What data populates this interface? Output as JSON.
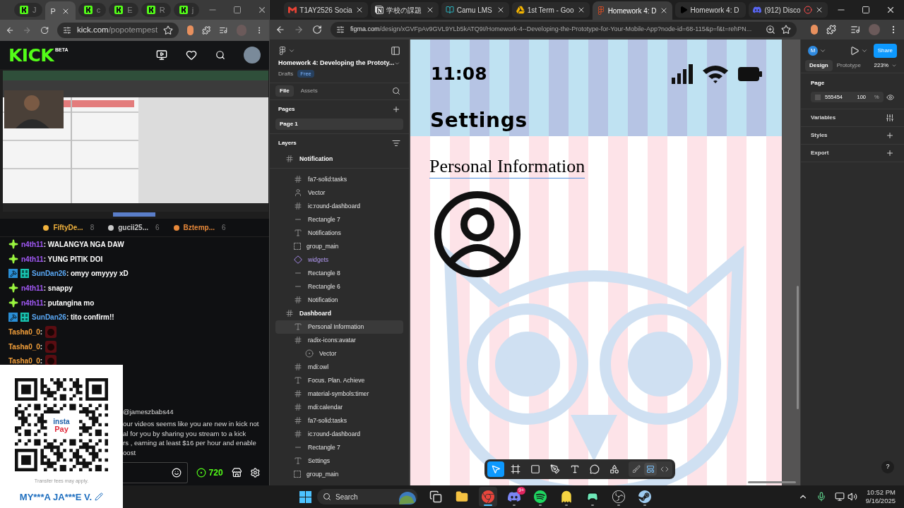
{
  "left_browser": {
    "tabs": [
      {
        "label": "J",
        "kind": "kick",
        "selected": false
      },
      {
        "label": "P",
        "kind": "none",
        "selected": true
      },
      {
        "label": "c",
        "kind": "kick",
        "selected": false
      },
      {
        "label": "E",
        "kind": "kick",
        "selected": false
      },
      {
        "label": "R",
        "kind": "kick",
        "selected": false
      },
      {
        "label": "j",
        "kind": "kick",
        "selected": false
      }
    ],
    "url": {
      "domain": "kick.com",
      "path": "/popotempest"
    },
    "site": {
      "logo": "KICK",
      "logo_badge": "BETA"
    },
    "gifters": [
      {
        "name": "FiftyDe...",
        "count": "8",
        "color": "#f2b33d"
      },
      {
        "name": "gucii25...",
        "count": "6",
        "color": "#c9c9c9"
      },
      {
        "name": "Bztemp...",
        "count": "6",
        "color": "#e8893a"
      }
    ],
    "chat": [
      {
        "user": "n4th11",
        "text": ": WALANGYA NGA DAW",
        "color": "#a259f7",
        "kind": "sparkle",
        "emote": false
      },
      {
        "user": "n4th11",
        "text": ": YUNG PITIK DOI",
        "color": "#a259f7",
        "kind": "sparkle",
        "emote": false
      },
      {
        "user": "SunDan26",
        "text": ": omyy omyyyy xD",
        "color": "#5aa8f5",
        "kind": "mod",
        "emote": false
      },
      {
        "user": "n4th11",
        "text": ": snappy",
        "color": "#a259f7",
        "kind": "sparkle",
        "emote": false
      },
      {
        "user": "n4th11",
        "text": ": putangina mo",
        "color": "#a259f7",
        "kind": "sparkle",
        "emote": false
      },
      {
        "user": "SunDan26",
        "text": ": tito confirm!!",
        "color": "#5aa8f5",
        "kind": "mod",
        "emote": false
      },
      {
        "user": "Tasha0_0",
        "text": ":",
        "color": "#f5a03a",
        "kind": "none",
        "emote": true
      },
      {
        "user": "Tasha0_0",
        "text": ":",
        "color": "#f5a03a",
        "kind": "none",
        "emote": true
      },
      {
        "user": "Tasha0_0",
        "text": ":",
        "color": "#f5a03a",
        "kind": "none",
        "emote": true
      }
    ],
    "partial_message": {
      "mention": "@jameszbabs44",
      "lines": [
        "our videos seems like you are new in kick not",
        "al for you by sharing you stream to a kick",
        "rs , earning at least $16 per hour and enable",
        "oost"
      ]
    },
    "chat_input": {
      "points": "720"
    },
    "qr_card": {
      "logo_top": "insta",
      "logo_bottom": "Pay",
      "note": "Transfer fees may apply.",
      "name": "MY***A JA***E V."
    }
  },
  "right_browser": {
    "tabs": [
      {
        "label": "T1AY2526 Socia",
        "kind": "gmail",
        "closable": true,
        "recording": false,
        "selected": false
      },
      {
        "label": "学校の課題",
        "kind": "notion",
        "closable": true,
        "recording": false,
        "selected": false
      },
      {
        "label": "Camu LMS",
        "kind": "camu",
        "closable": true,
        "recording": false,
        "selected": false
      },
      {
        "label": "1st Term - Goo",
        "kind": "drive",
        "closable": true,
        "recording": false,
        "selected": false
      },
      {
        "label": "Homework 4: D",
        "kind": "figma",
        "closable": true,
        "recording": false,
        "selected": true
      },
      {
        "label": "Homework 4: D",
        "kind": "youtube",
        "closable": false,
        "recording": false,
        "selected": false
      },
      {
        "label": "(912) Disco",
        "kind": "discord",
        "closable": true,
        "recording": true,
        "selected": false
      }
    ],
    "url": {
      "domain": "figma.com",
      "path": "/design/xGVFpAv9GVL9YLb5kATQ9I/Homework-4--Developing-the-Prototype-for-Your-Mobile-App?node-id=68-115&p=f&t=rehPN..."
    }
  },
  "figma": {
    "file": {
      "title": "Homework 4: Developing the Prototy...",
      "location": "Drafts",
      "plan": "Free"
    },
    "panel_tabs": [
      {
        "label": "File",
        "selected": true
      },
      {
        "label": "Assets",
        "selected": false
      }
    ],
    "pages_heading": "Pages",
    "pages": [
      {
        "label": "Page 1",
        "selected": true
      }
    ],
    "layers_heading": "Layers",
    "layers": [
      {
        "name": "Notification",
        "kind": "frame",
        "selected": false,
        "children": [
          {
            "name": "fa7-solid:tasks",
            "kind": "frame",
            "selected": false
          },
          {
            "name": "Vector",
            "kind": "person",
            "selected": false
          },
          {
            "name": "ic:round-dashboard",
            "kind": "frame",
            "selected": false
          },
          {
            "name": "Rectangle 7",
            "kind": "rectangle",
            "selected": false
          },
          {
            "name": "Notifications",
            "kind": "text",
            "selected": false
          },
          {
            "name": "group_main",
            "kind": "group",
            "selected": false
          },
          {
            "name": "widgets",
            "kind": "component",
            "selected": false
          },
          {
            "name": "Rectangle 8",
            "kind": "rectangle",
            "selected": false
          },
          {
            "name": "Rectangle 6",
            "kind": "rectangle",
            "selected": false
          },
          {
            "name": "Notification",
            "kind": "frame",
            "selected": false
          }
        ]
      },
      {
        "name": "Dashboard",
        "kind": "frame",
        "selected": false,
        "children": [
          {
            "name": "Personal Information",
            "kind": "text",
            "selected": true
          },
          {
            "name": "radix-icons:avatar",
            "kind": "frame",
            "selected": false,
            "children": [
              {
                "name": "Vector",
                "kind": "vector",
                "selected": false
              }
            ]
          },
          {
            "name": "mdi:owl",
            "kind": "frame",
            "selected": false
          },
          {
            "name": "Focus. Plan. Achieve",
            "kind": "text",
            "selected": false
          },
          {
            "name": "material-symbols:timer",
            "kind": "frame",
            "selected": false
          },
          {
            "name": "mdi:calendar",
            "kind": "frame",
            "selected": false
          },
          {
            "name": "fa7-solid:tasks",
            "kind": "frame",
            "selected": false
          },
          {
            "name": "ic:round-dashboard",
            "kind": "frame",
            "selected": false
          },
          {
            "name": "Rectangle 7",
            "kind": "rectangle",
            "selected": false
          },
          {
            "name": "Settings",
            "kind": "text",
            "selected": false
          },
          {
            "name": "group_main",
            "kind": "group",
            "selected": false
          }
        ]
      }
    ],
    "canvas": {
      "time": "11:08",
      "heading": "Settings",
      "section": "Personal Information"
    },
    "toolbar": [
      {
        "kind": "move",
        "selected": true
      },
      {
        "kind": "frame",
        "selected": false
      },
      {
        "kind": "rectangle",
        "selected": false
      },
      {
        "kind": "pen",
        "selected": false
      },
      {
        "kind": "text",
        "selected": false
      },
      {
        "kind": "comment",
        "selected": false
      },
      {
        "kind": "actions",
        "selected": false
      }
    ],
    "mode_toggles": [
      {
        "kind": "draw",
        "selected": false
      },
      {
        "kind": "design",
        "selected": true
      },
      {
        "kind": "dev",
        "selected": false
      }
    ],
    "right_panel": {
      "user_initial": "M",
      "share": "Share",
      "tabs": [
        {
          "label": "Design",
          "selected": true
        },
        {
          "label": "Prototype",
          "selected": false
        }
      ],
      "zoom": "223%",
      "page_heading": "Page",
      "page_color": {
        "hex": "555454",
        "opacity": "100",
        "unit": "%"
      },
      "sections": [
        {
          "label": "Variables",
          "kind": "variables"
        },
        {
          "label": "Styles",
          "kind": "add"
        },
        {
          "label": "Export",
          "kind": "add"
        }
      ]
    },
    "help": "?"
  },
  "taskbar": {
    "search": "Search",
    "apps": [
      {
        "kind": "task-view",
        "selected": false,
        "running": false
      },
      {
        "kind": "explorer",
        "selected": false,
        "running": false
      },
      {
        "kind": "chrome",
        "selected": true,
        "running": true
      },
      {
        "kind": "discord",
        "selected": false,
        "running": true,
        "badge": "9+"
      },
      {
        "kind": "spotify",
        "selected": false,
        "running": true
      },
      {
        "kind": "ghost",
        "selected": false,
        "running": true
      },
      {
        "kind": "chat-app",
        "selected": false,
        "running": true
      },
      {
        "kind": "obs",
        "selected": false,
        "running": true
      },
      {
        "kind": "steam",
        "selected": false,
        "running": true
      }
    ],
    "time": "10:52 PM",
    "date": "9/16/2025"
  }
}
